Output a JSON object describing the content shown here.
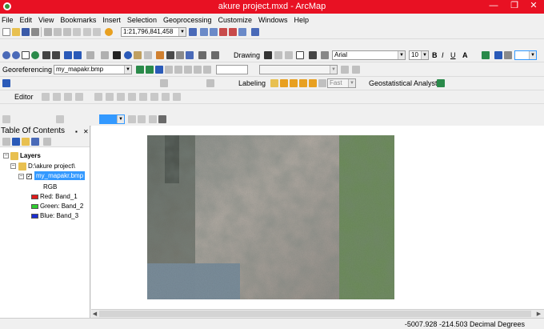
{
  "window": {
    "title": "akure project.mxd - ArcMap",
    "minimize_glyph": "—",
    "maximize_glyph": "❐",
    "close_glyph": "✕"
  },
  "menu": [
    "File",
    "Edit",
    "View",
    "Bookmarks",
    "Insert",
    "Selection",
    "Geoprocessing",
    "Customize",
    "Windows",
    "Help"
  ],
  "standard_toolbar": {
    "scale_value": "1:21,796,841,458"
  },
  "tools_toolbar": {
    "drawing_label": "Drawing",
    "font_name": "Arial",
    "font_size": "10",
    "bold_label": "B",
    "italic_label": "I",
    "underline_label": "U",
    "font_color_label": "A"
  },
  "georef_toolbar": {
    "label": "Georeferencing",
    "layer_value": "my_mapakr.bmp",
    "labeling_label": "Labeling",
    "fast_label": "Fast",
    "geostat_label": "Geostatistical Analyst"
  },
  "editor_toolbar": {
    "label": "Editor"
  },
  "toc": {
    "title": "Table Of Contents",
    "pin_glyph": "✕",
    "layers_label": "Layers",
    "folder_label": "D:\\akure project\\",
    "layer_name": "my_mapakr.bmp",
    "rgb_label": "RGB",
    "bands": [
      {
        "channel": "Red:",
        "band": "Band_1",
        "color": "#e01b1b"
      },
      {
        "channel": "Green:",
        "band": "Band_2",
        "color": "#2ecc2e"
      },
      {
        "channel": "Blue:",
        "band": "Band_3",
        "color": "#1a2ed1"
      }
    ]
  },
  "status": {
    "coords": "-5007.928  -214.503 Decimal Degrees"
  },
  "colors": {
    "titlebar": "#e81123",
    "selection": "#3399ff"
  }
}
